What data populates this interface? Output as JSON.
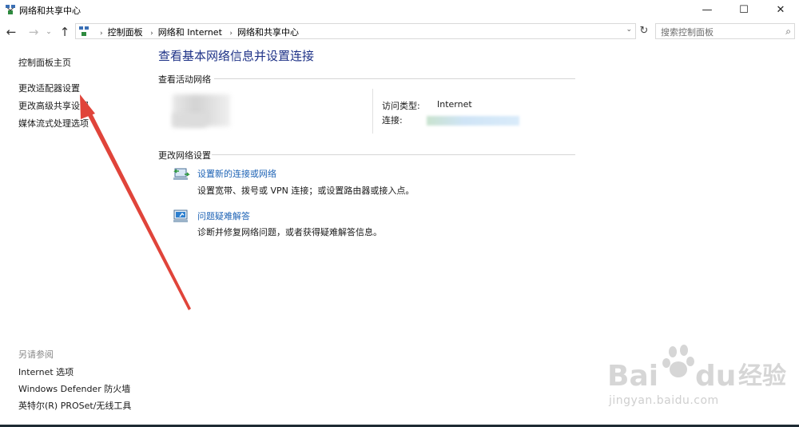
{
  "window": {
    "title": "网络和共享中心",
    "controls": {
      "minimize": "—",
      "maximize": "☐",
      "close": "✕"
    }
  },
  "nav": {
    "back_icon": "←",
    "forward_icon": "→",
    "recent_icon": "⌄",
    "up_icon": "↑",
    "breadcrumbs": [
      "控制面板",
      "网络和 Internet",
      "网络和共享中心"
    ],
    "separator": "›",
    "dropdown_icon": "⌄",
    "refresh_icon": "↻",
    "search_placeholder": "搜索控制面板",
    "search_icon": "⌕"
  },
  "sidebar": {
    "links": [
      "控制面板主页",
      "更改适配器设置",
      "更改高级共享设置",
      "媒体流式处理选项"
    ],
    "see_also_heading": "另请参阅",
    "see_also": [
      "Internet 选项",
      "Windows Defender 防火墙",
      "英特尔(R) PROSet/无线工具"
    ]
  },
  "main": {
    "title": "查看基本网络信息并设置连接",
    "active_networks_heading": "查看活动网络",
    "access_type_label": "访问类型:",
    "access_type_value": "Internet",
    "connection_label": "连接:",
    "change_settings_heading": "更改网络设置",
    "items": [
      {
        "icon": "network-setup-icon",
        "link": "设置新的连接或网络",
        "desc": "设置宽带、拨号或 VPN 连接；或设置路由器或接入点。"
      },
      {
        "icon": "troubleshoot-icon",
        "link": "问题疑难解答",
        "desc": "诊断并修复网络问题，或者获得疑难解答信息。"
      }
    ]
  },
  "annotation": {
    "arrow_color": "#e0443a"
  },
  "watermark": {
    "brand": "Bai du 经验",
    "url": "jingyan.baidu.com"
  }
}
